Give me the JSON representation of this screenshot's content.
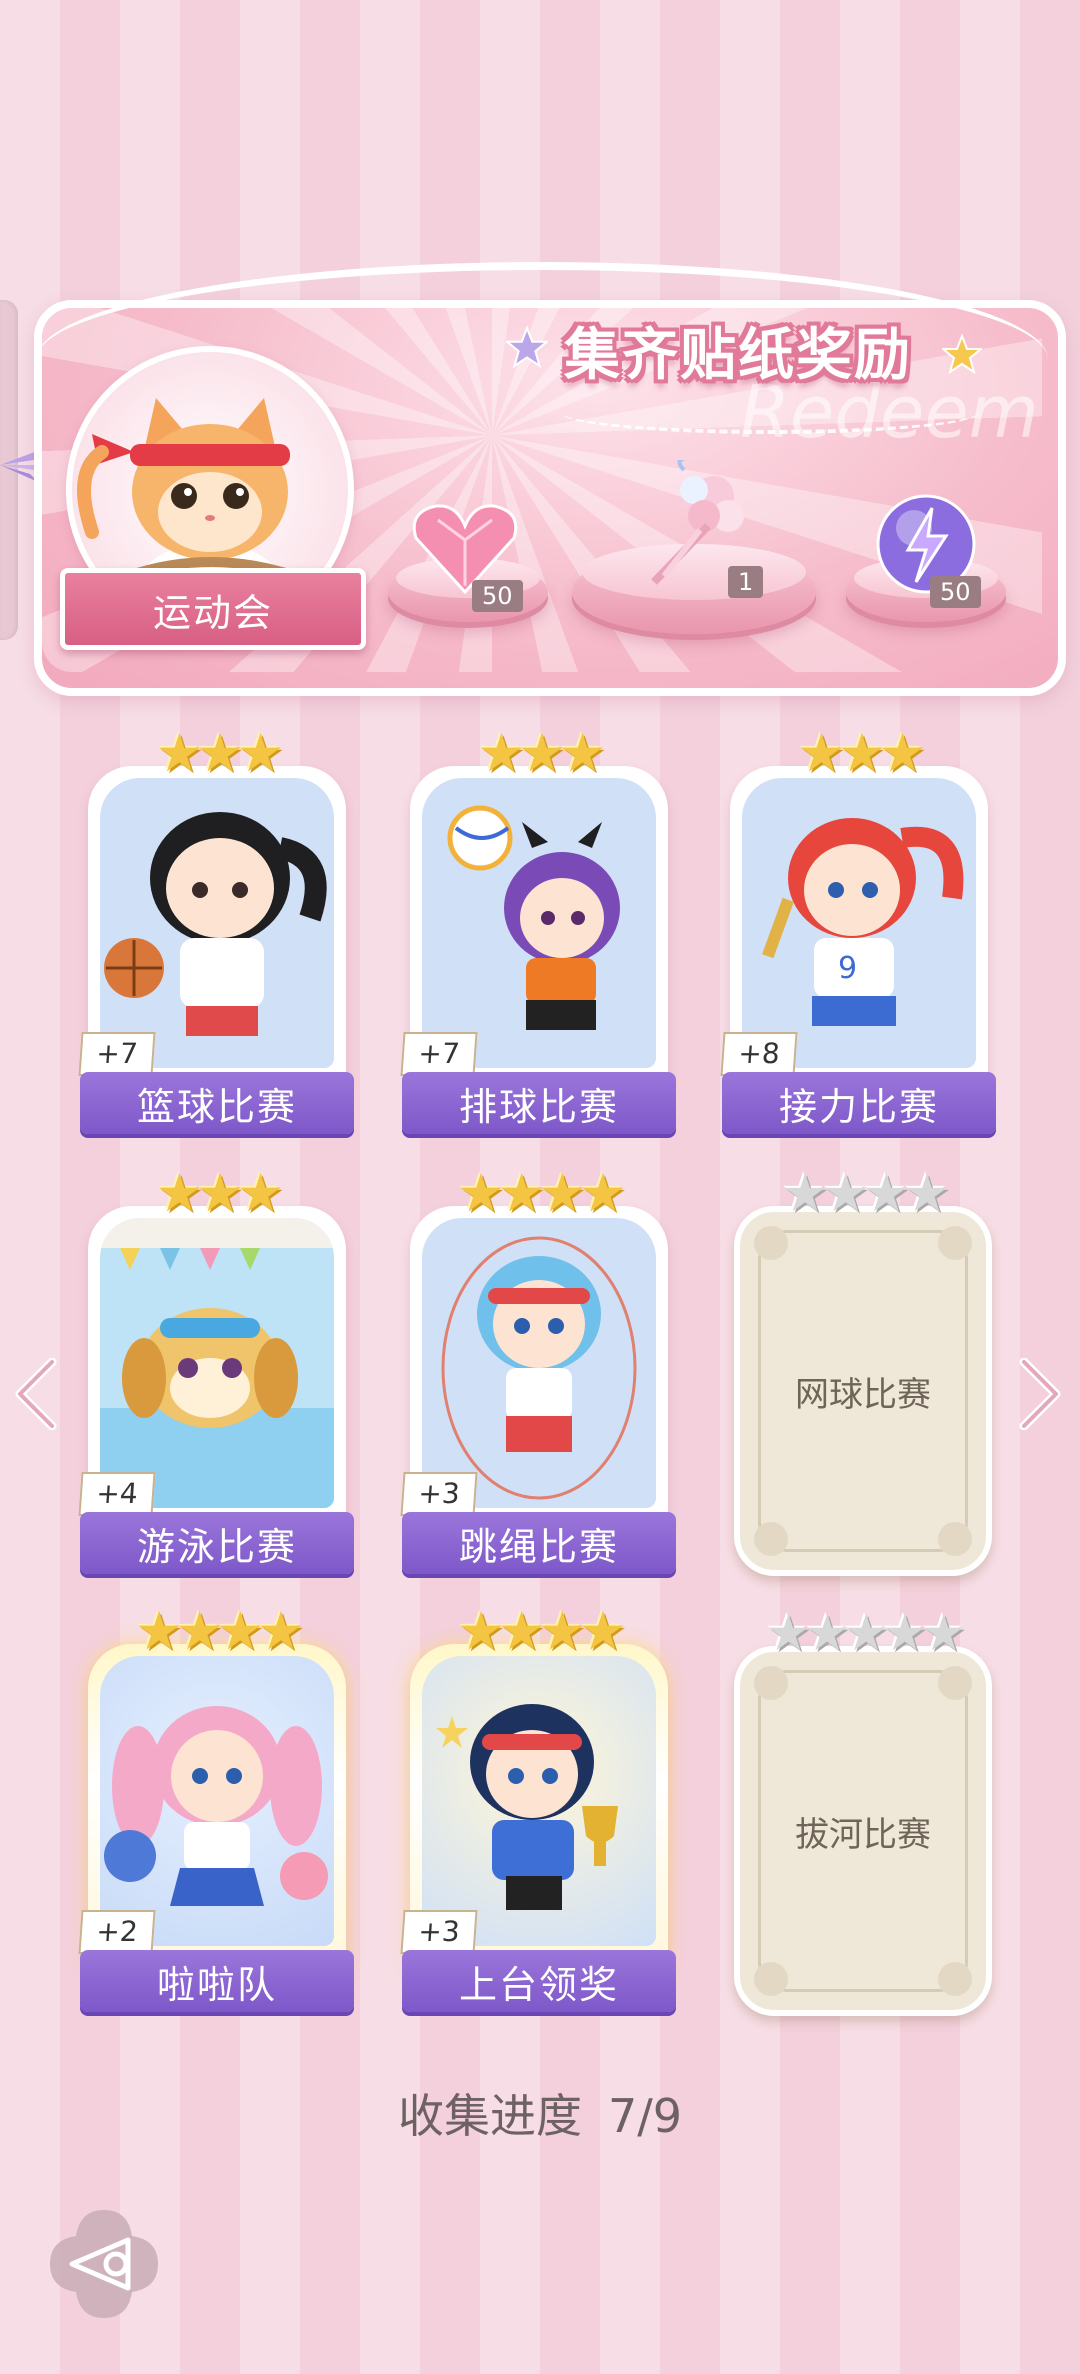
{
  "banner": {
    "title": "集齐贴纸奖励",
    "watermark": "Redeem",
    "event_name": "运动会",
    "rewards": [
      {
        "name": "heart-gem-icon",
        "count": "50"
      },
      {
        "name": "flower-bouquet-icon",
        "count": "1"
      },
      {
        "name": "lightning-orb-icon",
        "count": "50"
      }
    ]
  },
  "stickers": [
    {
      "name": "篮球比赛",
      "stars": 3,
      "bonus": "+7",
      "collected": true
    },
    {
      "name": "排球比赛",
      "stars": 3,
      "bonus": "+7",
      "collected": true
    },
    {
      "name": "接力比赛",
      "stars": 3,
      "bonus": "+8",
      "collected": true
    },
    {
      "name": "游泳比赛",
      "stars": 3,
      "bonus": "+4",
      "collected": true
    },
    {
      "name": "跳绳比赛",
      "stars": 4,
      "bonus": "+3",
      "collected": true
    },
    {
      "name": "网球比赛",
      "stars": 4,
      "bonus": "",
      "collected": false
    },
    {
      "name": "啦啦队",
      "stars": 4,
      "bonus": "+2",
      "collected": true,
      "gold": true
    },
    {
      "name": "上台领奖",
      "stars": 4,
      "bonus": "+3",
      "collected": true,
      "gold": true
    },
    {
      "name": "拔河比赛",
      "stars": 5,
      "bonus": "",
      "collected": false
    }
  ],
  "progress": {
    "label": "收集进度",
    "value": "7/9"
  },
  "colors": {
    "accent_purple": "#8a64d2",
    "pink": "#f2a9bd",
    "gold": "#f4c542"
  }
}
